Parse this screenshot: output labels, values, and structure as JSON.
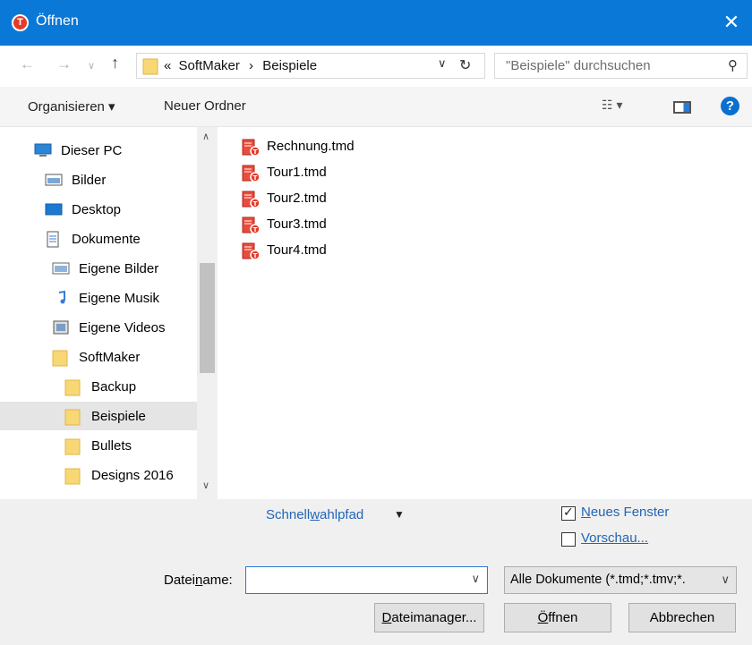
{
  "window": {
    "title": "Öffnen",
    "close_glyph": "✕"
  },
  "address": {
    "prefix": "«",
    "crumbs": [
      "SoftMaker",
      "Beispiele"
    ],
    "search_placeholder": "\"Beispiele\" durchsuchen"
  },
  "toolbar": {
    "organize_label": "Organisieren ▾",
    "new_folder_label": "Neuer Ordner"
  },
  "nav": [
    {
      "label": "Dieser PC",
      "icon": "pc-icon",
      "indent": 0,
      "selected": false
    },
    {
      "label": "Bilder",
      "icon": "pictures-icon",
      "indent": 1,
      "selected": false
    },
    {
      "label": "Desktop",
      "icon": "desktop-icon",
      "indent": 1,
      "selected": false
    },
    {
      "label": "Dokumente",
      "icon": "documents-icon",
      "indent": 1,
      "selected": false
    },
    {
      "label": "Eigene Bilder",
      "icon": "my-pictures-icon",
      "indent": 2,
      "selected": false
    },
    {
      "label": "Eigene Musik",
      "icon": "music-icon",
      "indent": 2,
      "selected": false
    },
    {
      "label": "Eigene Videos",
      "icon": "videos-icon",
      "indent": 2,
      "selected": false
    },
    {
      "label": "SoftMaker",
      "icon": "folder-icon",
      "indent": 2,
      "selected": false
    },
    {
      "label": "Backup",
      "icon": "folder-icon",
      "indent": 3,
      "selected": false
    },
    {
      "label": "Beispiele",
      "icon": "folder-icon",
      "indent": 3,
      "selected": true
    },
    {
      "label": "Bullets",
      "icon": "folder-icon",
      "indent": 3,
      "selected": false
    },
    {
      "label": "Designs 2016",
      "icon": "folder-icon",
      "indent": 3,
      "selected": false
    }
  ],
  "files": [
    "Rechnung.tmd",
    "Tour1.tmd",
    "Tour2.tmd",
    "Tour3.tmd",
    "Tour4.tmd"
  ],
  "bottom": {
    "quick_path_pre": "Schnell",
    "quick_path_u": "w",
    "quick_path_post": "ahlpfad",
    "new_window_u": "N",
    "new_window_rest": "eues Fenster",
    "new_window_checked": true,
    "preview_label": "Vorschau...",
    "preview_checked": false,
    "filename_pre": "Datei",
    "filename_u": "n",
    "filename_post": "ame:",
    "filename_value": "",
    "filter_value": "Alle Dokumente (*.tmd;*.tmv;*.",
    "filemanager_u": "D",
    "filemanager_rest": "ateimanager...",
    "open_u": "Ö",
    "open_rest": "ffnen",
    "cancel_label": "Abbrechen"
  },
  "colors": {
    "titlebar": "#0a78d7",
    "accent_link": "#2365b5",
    "selection": "#e5e5e5"
  }
}
